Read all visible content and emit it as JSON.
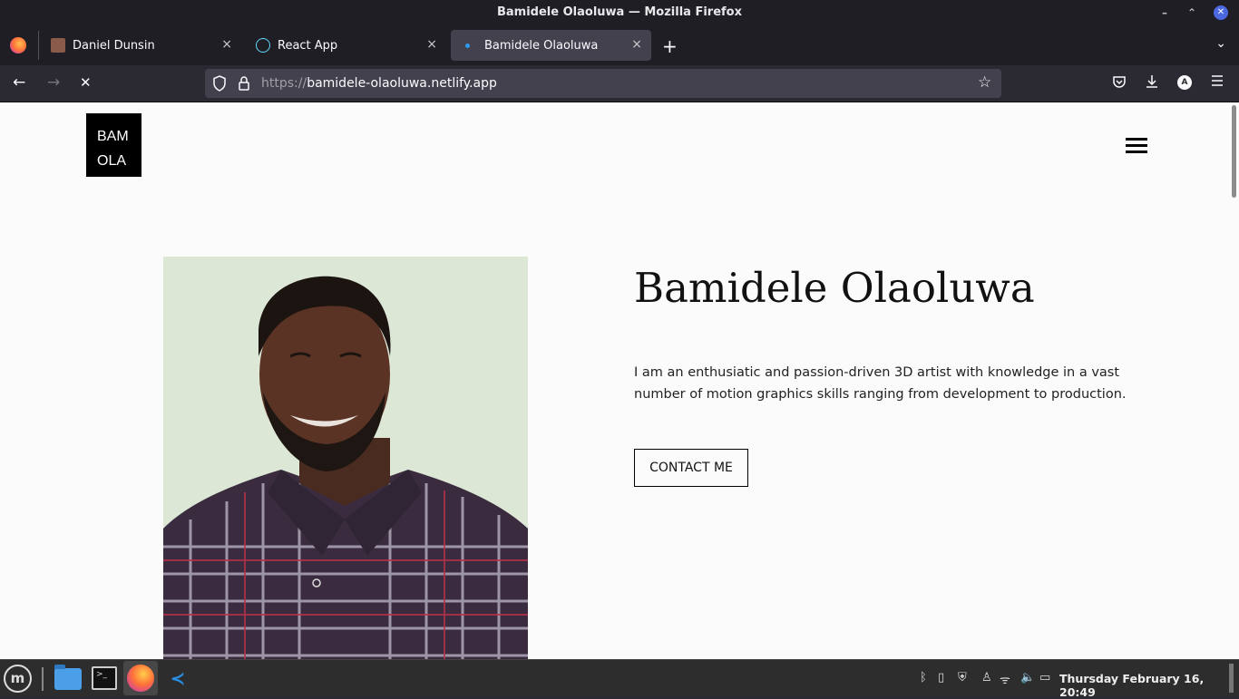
{
  "window": {
    "title": "Bamidele Olaoluwa — Mozilla Firefox",
    "minimize_icon": "minimize-icon",
    "maximize_icon": "maximize-icon",
    "close_icon": "close-icon"
  },
  "tabs": [
    {
      "label": "Daniel Dunsin",
      "close": "×",
      "active": false
    },
    {
      "label": "React App",
      "close": "×",
      "active": false
    },
    {
      "label": "Bamidele Olaoluwa",
      "close": "×",
      "active": true
    }
  ],
  "new_tab_label": "+",
  "tab_list_label": "⌄",
  "toolbar": {
    "back": "←",
    "forward": "→",
    "stop": "✕",
    "url_protocol": "https://",
    "url_host": "bamidele-olaoluwa.netlify.app",
    "bookmark_star": "☆",
    "account_initial": "A"
  },
  "page": {
    "logo_line1": "BAM",
    "logo_line2": "OLA",
    "hero_name": "Bamidele Olaoluwa",
    "hero_bio": "I am an enthusiatic and passion-driven 3D artist with knowledge in a vast number of motion graphics skills ranging from development to production.",
    "contact_button": "CONTACT ME"
  },
  "taskbar": {
    "menu_label": "m",
    "terminal_prompt": ">_",
    "vscode_glyph": "≺",
    "clock": "Thursday February 16, 20:49"
  },
  "colors": {
    "accent": "#4b68e1",
    "page_bg": "#fbfbfb",
    "chrome_bg": "#2b2a33"
  }
}
